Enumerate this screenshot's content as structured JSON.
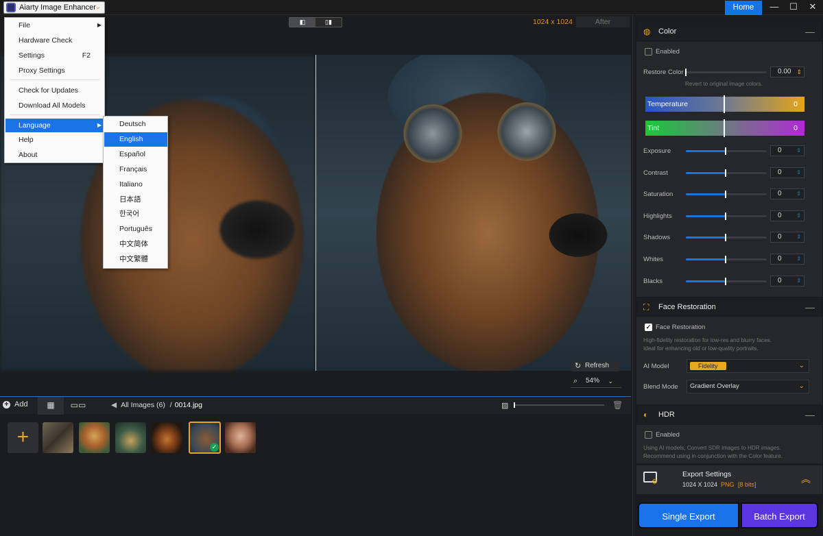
{
  "app": {
    "title": "Aiarty Image Enhancer",
    "home": "Home"
  },
  "window": {
    "minimize": "—",
    "maximize": "☐",
    "close": "✕"
  },
  "viewer": {
    "resolution": "1024 x 1024",
    "after_label": "After",
    "refresh": "Refresh",
    "zoom": "54%"
  },
  "menu": {
    "items": [
      {
        "label": "File",
        "shortcut": "",
        "submenu": true
      },
      {
        "label": "Hardware Check",
        "shortcut": ""
      },
      {
        "label": "Settings",
        "shortcut": "F2"
      },
      {
        "label": "Proxy Settings",
        "shortcut": ""
      },
      {
        "label": "Check for Updates",
        "shortcut": ""
      },
      {
        "label": "Download All Models",
        "shortcut": ""
      },
      {
        "label": "Language",
        "shortcut": "",
        "submenu": true,
        "selected": true
      },
      {
        "label": "Help",
        "shortcut": ""
      },
      {
        "label": "About",
        "shortcut": ""
      }
    ]
  },
  "languages": [
    "Deutsch",
    "English",
    "Español",
    "Français",
    "Italiano",
    "日本語",
    "한국어",
    "Português",
    "中文简体",
    "中文繁體"
  ],
  "selected_language": "English",
  "bottombar": {
    "add": "Add",
    "all_images": "All Images (6)",
    "separator": "/",
    "file": "0014.jpg"
  },
  "color": {
    "title": "Color",
    "enabled_label": "Enabled",
    "enabled": false,
    "restore_label": "Restore Color",
    "restore_value": "0.00",
    "restore_hint": "Revert to original image colors.",
    "temperature_label": "Temperature",
    "temperature_value": "0",
    "tint_label": "Tint",
    "tint_value": "0",
    "adjustments": [
      {
        "label": "Exposure",
        "value": "0"
      },
      {
        "label": "Contrast",
        "value": "0"
      },
      {
        "label": "Saturation",
        "value": "0"
      },
      {
        "label": "Highlights",
        "value": "0"
      },
      {
        "label": "Shadows",
        "value": "0"
      },
      {
        "label": "Whites",
        "value": "0"
      },
      {
        "label": "Blacks",
        "value": "0"
      }
    ]
  },
  "face": {
    "title": "Face Restoration",
    "checkbox_label": "Face Restoration",
    "enabled": true,
    "hint1": "High-fidelity restoration for low-res and blurry faces.",
    "hint2": "Ideal for enhancing old or low-quality portraits.",
    "ai_model_label": "AI Model",
    "ai_model_value": "Fidelity",
    "blend_label": "Blend Mode",
    "blend_value": "Gradient Overlay"
  },
  "hdr": {
    "title": "HDR",
    "enabled_label": "Enabled",
    "enabled": false,
    "hint1": "Using AI models, Convert SDR images to HDR images.",
    "hint2": "Recommend using in conjunction with the Color feature."
  },
  "export": {
    "title": "Export Settings",
    "size": "1024 X 1024",
    "format": "PNG",
    "bits": "[8 bits]",
    "single": "Single Export",
    "batch": "Batch Export"
  },
  "colors": {
    "accent": "#1a73e8",
    "orange": "#e3921c",
    "batch": "#5b36e0"
  }
}
